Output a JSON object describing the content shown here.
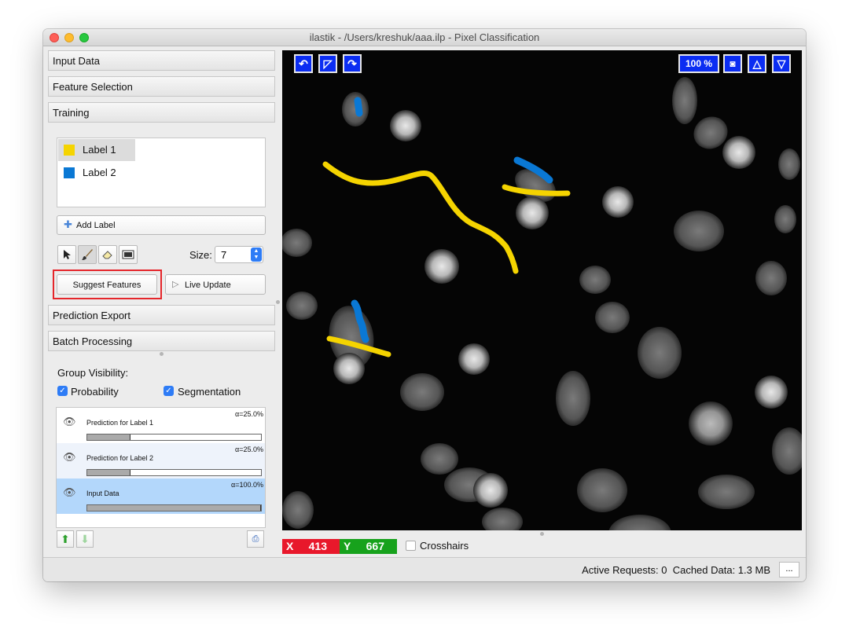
{
  "window": {
    "title": "ilastik - /Users/kreshuk/aaa.ilp - Pixel Classification"
  },
  "applets": {
    "input_data": "Input Data",
    "feature_selection": "Feature Selection",
    "training": "Training",
    "prediction_export": "Prediction Export",
    "batch_processing": "Batch Processing"
  },
  "labels": [
    {
      "name": "Label 1",
      "color": "#f5d400"
    },
    {
      "name": "Label 2",
      "color": "#0a78d4"
    }
  ],
  "training": {
    "add_label": "Add Label",
    "size_label": "Size:",
    "size_value": "7",
    "suggest_features": "Suggest Features",
    "live_update": "Live Update",
    "tools": [
      "pointer-icon",
      "brush-icon",
      "eraser-icon",
      "threshold-icon"
    ]
  },
  "group_visibility": {
    "title": "Group Visibility:",
    "probability": "Probability",
    "segmentation": "Segmentation",
    "probability_checked": true,
    "segmentation_checked": true
  },
  "layers": [
    {
      "name": "Prediction for Label 1",
      "alpha": "α=25.0%",
      "opacity": 0.25
    },
    {
      "name": "Prediction for Label 2",
      "alpha": "α=25.0%",
      "opacity": 0.25
    },
    {
      "name": "Input Data",
      "alpha": "α=100.0%",
      "opacity": 1.0
    }
  ],
  "viewer": {
    "zoom": "100 %",
    "x_label": "X",
    "x_value": "413",
    "y_label": "Y",
    "y_value": "667",
    "crosshairs": "Crosshairs",
    "x_color": "#e8182b",
    "y_color": "#17a21c",
    "button_color": "#0b2df2"
  },
  "status": {
    "active_requests": "Active Requests: 0",
    "cached_data": "Cached Data: 1.3 MB",
    "more": "..."
  }
}
